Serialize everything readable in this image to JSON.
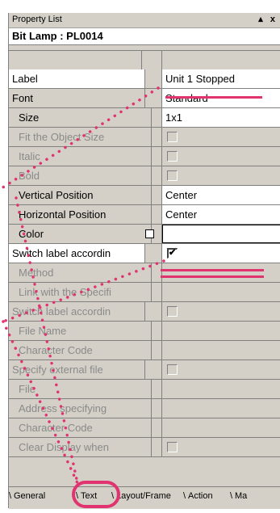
{
  "window": {
    "title": "Property List",
    "controls": "▴ x",
    "object_title": "Bit Lamp : PL0014"
  },
  "rows": [
    {
      "label": "Label",
      "value": "Unit 1 Stopped",
      "state": "normal"
    },
    {
      "label": "Font",
      "value": "Standard",
      "state": "normal"
    },
    {
      "label": "Size",
      "value": "1x1",
      "state": "normal",
      "indent": true
    },
    {
      "label": "Fit the Object Size",
      "state": "disabled",
      "indent": true,
      "checkbox": true
    },
    {
      "label": "Italic",
      "state": "disabled",
      "indent": true,
      "checkbox": true
    },
    {
      "label": "Bold",
      "state": "disabled",
      "indent": true,
      "checkbox": true
    },
    {
      "label": "Vertical Position",
      "value": "Center",
      "state": "normal",
      "indent": true
    },
    {
      "label": "Horizontal Position",
      "value": "Center",
      "state": "normal",
      "indent": true
    },
    {
      "label": "Color",
      "state": "normal",
      "indent": true,
      "colorfield": true
    },
    {
      "label": "Switch label accordin",
      "state": "normal",
      "checkbox_checked": true
    },
    {
      "label": "Method",
      "state": "disabled",
      "indent": true
    },
    {
      "label": "Link with the Specifi",
      "state": "disabled",
      "indent": true
    },
    {
      "label": "Switch label accordin",
      "state": "disabled",
      "checkbox": true
    },
    {
      "label": "File Name",
      "state": "disabled",
      "indent": true
    },
    {
      "label": "Character Code",
      "state": "disabled",
      "indent": true
    },
    {
      "label": "Specify external file",
      "state": "disabled",
      "checkbox": true
    },
    {
      "label": "File",
      "state": "disabled",
      "indent": true
    },
    {
      "label": "Address specifying",
      "state": "disabled",
      "indent": true
    },
    {
      "label": "Character Code",
      "state": "disabled",
      "indent": true
    },
    {
      "label": "Clear Display when",
      "state": "disabled",
      "indent": true,
      "checkbox": true
    }
  ],
  "tabs": [
    {
      "label": "General"
    },
    {
      "label": "Text"
    },
    {
      "label": "Layout/Frame"
    },
    {
      "label": "Action"
    },
    {
      "label": "Ma"
    }
  ],
  "annotation_color": "#e0336f",
  "check_mark": "✔"
}
